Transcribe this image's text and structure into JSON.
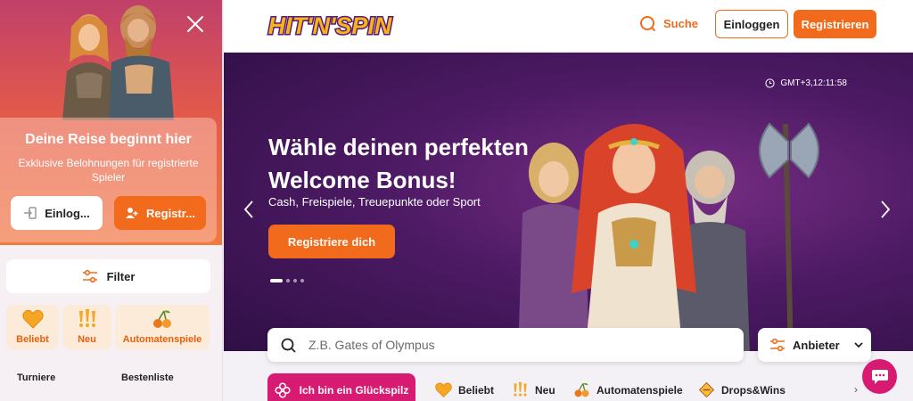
{
  "sidebar": {
    "card_title": "Deine Reise beginnt hier",
    "card_subtitle": "Exklusive Belohnungen für registrierte Spieler",
    "login_label": "Einlog...",
    "register_label": "Registr...",
    "filter_label": "Filter",
    "categories": [
      {
        "label": "Beliebt",
        "icon": "heart-icon"
      },
      {
        "label": "Neu",
        "icon": "exclamation-icon"
      },
      {
        "label": "Automatenspiele",
        "icon": "cherry-icon"
      }
    ],
    "links": [
      "Turniere",
      "Bestenliste"
    ]
  },
  "header": {
    "logo_text": "HIT'N'SPIN",
    "search_label": "Suche",
    "login_label": "Einloggen",
    "register_label": "Registrieren"
  },
  "banner": {
    "clock": "GMT+3,12:11:58",
    "title_line1": "Wähle deinen perfekten",
    "title_line2": "Welcome Bonus!",
    "subtitle": "Cash, Freispiele, Treuepunkte oder Sport",
    "cta_label": "Registriere dich",
    "slide_count": 4,
    "active_slide": 1
  },
  "search": {
    "placeholder": "Z.B. Gates of Olympus",
    "value": ""
  },
  "provider": {
    "label": "Anbieter"
  },
  "category_bar": {
    "lucky_label": "Ich bin ein Glückspilz",
    "items": [
      {
        "label": "Beliebt",
        "icon": "heart-icon"
      },
      {
        "label": "Neu",
        "icon": "exclamation-icon"
      },
      {
        "label": "Automatenspiele",
        "icon": "cherry-icon"
      },
      {
        "label": "Drops&Wins",
        "icon": "drops-wins-icon"
      }
    ]
  },
  "colors": {
    "accent": "#f26a1b",
    "pink": "#d81b72",
    "banner_purple": "#4d1a64"
  }
}
